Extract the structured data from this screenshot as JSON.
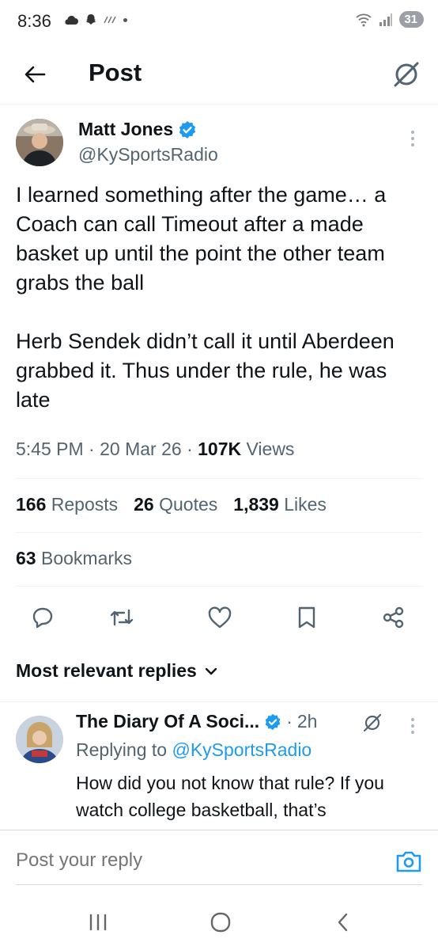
{
  "status_bar": {
    "time": "8:36",
    "battery": "31"
  },
  "header": {
    "title": "Post"
  },
  "tweet": {
    "author_name": "Matt Jones",
    "author_handle": "@KySportsRadio",
    "text": "I learned something after the game… a Coach can call Timeout after a made basket up until the point the other team grabs the ball\n\nHerb Sendek didn’t call it until Aberdeen grabbed it. Thus under the rule, he was late",
    "time": "5:45 PM",
    "date": "20 Mar 26",
    "views_count": "107K",
    "views_label": "Views",
    "reposts_count": "166",
    "reposts_label": "Reposts",
    "quotes_count": "26",
    "quotes_label": "Quotes",
    "likes_count": "1,839",
    "likes_label": "Likes",
    "bookmarks_count": "63",
    "bookmarks_label": "Bookmarks"
  },
  "actions": {
    "reply": "reply-icon",
    "repost": "repost-icon",
    "like": "heart-icon",
    "bookmark": "bookmark-icon",
    "share": "share-icon"
  },
  "replies_section": {
    "label": "Most relevant replies"
  },
  "reply": {
    "author_name": "The Diary Of A Soci...",
    "time": "2h",
    "replying_prefix": "Replying to",
    "replying_handle": "@KySportsRadio",
    "text": "How did you not know that rule? If you watch college basketball, that’s"
  },
  "compose": {
    "placeholder": "Post your reply"
  },
  "colors": {
    "accent": "#1d9bf0",
    "text": "#0f1419",
    "secondary": "#536471"
  }
}
